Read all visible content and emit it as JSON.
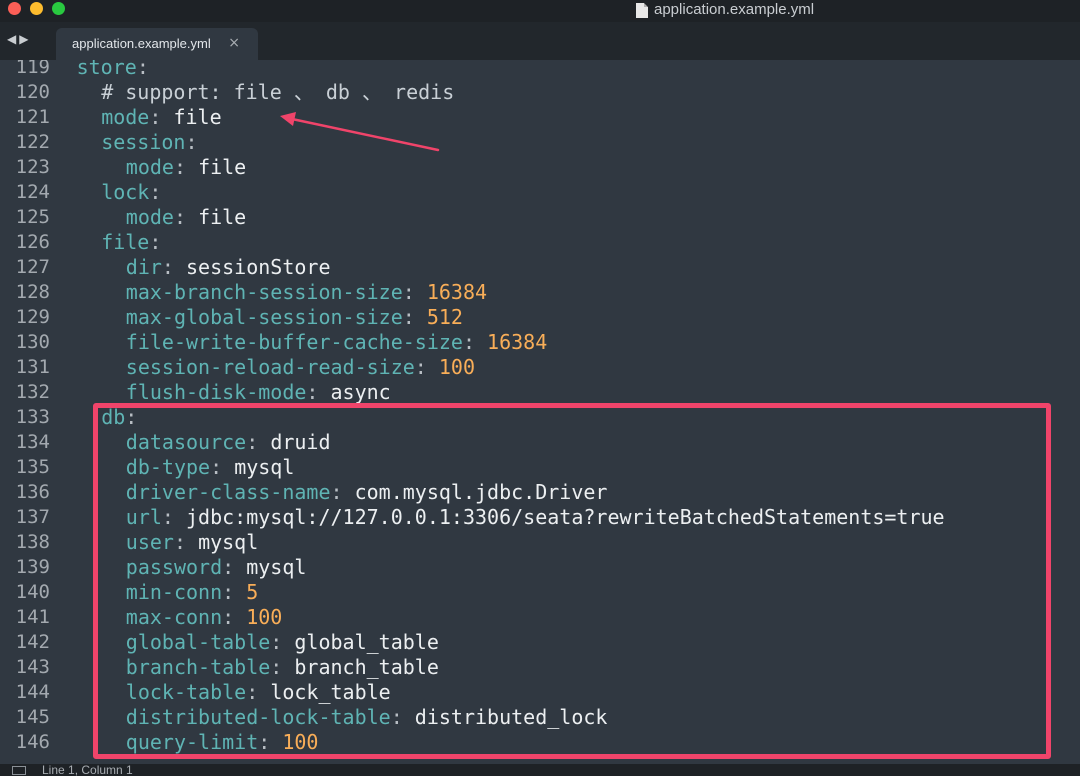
{
  "window": {
    "title": "application.example.yml"
  },
  "tabs": [
    {
      "label": "application.example.yml",
      "close_glyph": "×"
    }
  ],
  "nav": {
    "back": "◀",
    "forward": "▶"
  },
  "code": {
    "lines": [
      {
        "n": "119",
        "indent": 1,
        "key": "store",
        "sep": ":",
        "value": "",
        "type": ""
      },
      {
        "n": "120",
        "indent": 2,
        "comment": "# support: file 、 db 、 redis"
      },
      {
        "n": "121",
        "indent": 2,
        "key": "mode",
        "sep": ": ",
        "value": "file",
        "type": "str"
      },
      {
        "n": "122",
        "indent": 2,
        "key": "session",
        "sep": ":",
        "value": "",
        "type": ""
      },
      {
        "n": "123",
        "indent": 3,
        "key": "mode",
        "sep": ": ",
        "value": "file",
        "type": "str"
      },
      {
        "n": "124",
        "indent": 2,
        "key": "lock",
        "sep": ":",
        "value": "",
        "type": ""
      },
      {
        "n": "125",
        "indent": 3,
        "key": "mode",
        "sep": ": ",
        "value": "file",
        "type": "str"
      },
      {
        "n": "126",
        "indent": 2,
        "key": "file",
        "sep": ":",
        "value": "",
        "type": ""
      },
      {
        "n": "127",
        "indent": 3,
        "key": "dir",
        "sep": ": ",
        "value": "sessionStore",
        "type": "str"
      },
      {
        "n": "128",
        "indent": 3,
        "key": "max-branch-session-size",
        "sep": ": ",
        "value": "16384",
        "type": "num"
      },
      {
        "n": "129",
        "indent": 3,
        "key": "max-global-session-size",
        "sep": ": ",
        "value": "512",
        "type": "num"
      },
      {
        "n": "130",
        "indent": 3,
        "key": "file-write-buffer-cache-size",
        "sep": ": ",
        "value": "16384",
        "type": "num"
      },
      {
        "n": "131",
        "indent": 3,
        "key": "session-reload-read-size",
        "sep": ": ",
        "value": "100",
        "type": "num"
      },
      {
        "n": "132",
        "indent": 3,
        "key": "flush-disk-mode",
        "sep": ": ",
        "value": "async",
        "type": "str"
      },
      {
        "n": "133",
        "indent": 2,
        "key": "db",
        "sep": ":",
        "value": "",
        "type": ""
      },
      {
        "n": "134",
        "indent": 3,
        "key": "datasource",
        "sep": ": ",
        "value": "druid",
        "type": "str"
      },
      {
        "n": "135",
        "indent": 3,
        "key": "db-type",
        "sep": ": ",
        "value": "mysql",
        "type": "str"
      },
      {
        "n": "136",
        "indent": 3,
        "key": "driver-class-name",
        "sep": ": ",
        "value": "com.mysql.jdbc.Driver",
        "type": "str"
      },
      {
        "n": "137",
        "indent": 3,
        "key": "url",
        "sep": ": ",
        "value": "jdbc:mysql://127.0.0.1:3306/seata?rewriteBatchedStatements=true",
        "type": "str"
      },
      {
        "n": "138",
        "indent": 3,
        "key": "user",
        "sep": ": ",
        "value": "mysql",
        "type": "str"
      },
      {
        "n": "139",
        "indent": 3,
        "key": "password",
        "sep": ": ",
        "value": "mysql",
        "type": "str"
      },
      {
        "n": "140",
        "indent": 3,
        "key": "min-conn",
        "sep": ": ",
        "value": "5",
        "type": "num"
      },
      {
        "n": "141",
        "indent": 3,
        "key": "max-conn",
        "sep": ": ",
        "value": "100",
        "type": "num"
      },
      {
        "n": "142",
        "indent": 3,
        "key": "global-table",
        "sep": ": ",
        "value": "global_table",
        "type": "str"
      },
      {
        "n": "143",
        "indent": 3,
        "key": "branch-table",
        "sep": ": ",
        "value": "branch_table",
        "type": "str"
      },
      {
        "n": "144",
        "indent": 3,
        "key": "lock-table",
        "sep": ": ",
        "value": "lock_table",
        "type": "str"
      },
      {
        "n": "145",
        "indent": 3,
        "key": "distributed-lock-table",
        "sep": ": ",
        "value": "distributed_lock",
        "type": "str"
      },
      {
        "n": "146",
        "indent": 3,
        "key": "query-limit",
        "sep": ": ",
        "value": "100",
        "type": "num"
      }
    ]
  },
  "colors": {
    "background": "#303841",
    "key": "#5fb4b4",
    "number": "#f9ae58",
    "annotation": "#f0446a"
  },
  "icons": {
    "file": "document-icon",
    "close": "close-icon",
    "status": "panel-toggle-icon"
  },
  "status": {
    "text": "Line 1, Column 1"
  }
}
